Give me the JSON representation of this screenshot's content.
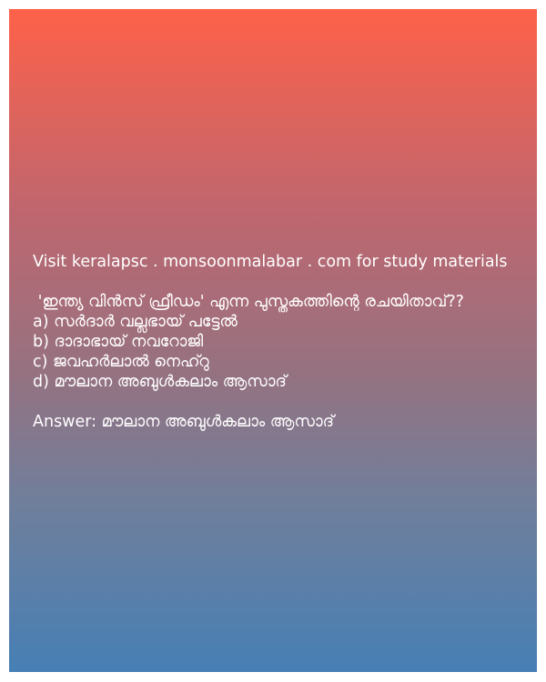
{
  "promo": "Visit keralapsc . monsoonmalabar . com for study materials",
  "question": " 'ഇന്ത്യ വിൻസ് ഫ്രീഡം' എന്ന പുസ്തകത്തിന്റെ രചയിതാവ്??",
  "options": [
    "a) സർദാർ വല്ലഭായ് പട്ടേൽ",
    "b) ദാദാഭായ് നവറോജി",
    "c) ജവഹർലാൽ നെഹ്റു",
    "d) മൗലാന അബുൾകലാം ആസാദ്"
  ],
  "answer": "Answer: മൗലാന അബുൾകലാം ആസാദ്"
}
